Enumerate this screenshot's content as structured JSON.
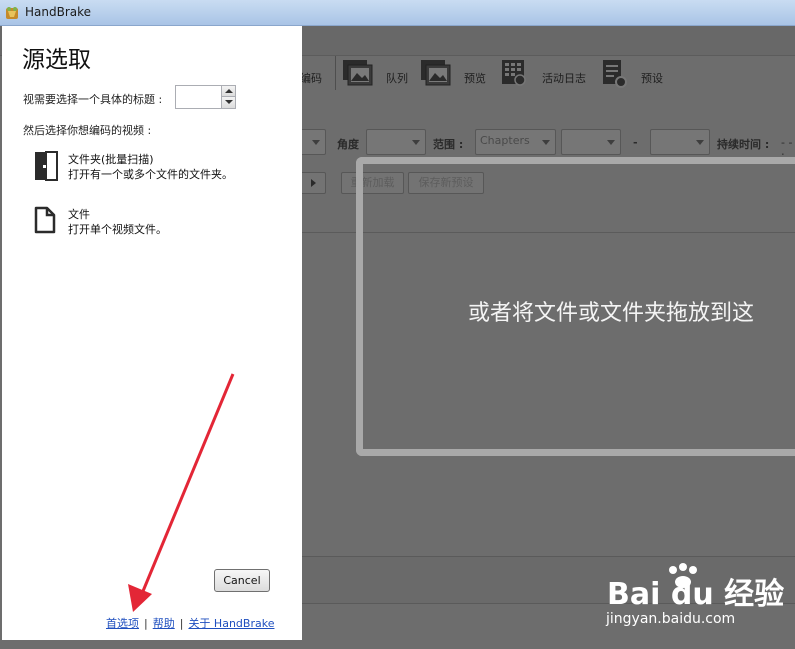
{
  "window": {
    "title": "HandBrake"
  },
  "toolbar": {
    "items": [
      {
        "label": "编码",
        "icon": "encode-icon"
      },
      {
        "label": "队列",
        "icon": "queue-icon"
      },
      {
        "label": "预览",
        "icon": "preview-icon"
      },
      {
        "label": "活动日志",
        "icon": "activity-log-icon"
      },
      {
        "label": "预设",
        "icon": "presets-icon"
      }
    ]
  },
  "source_bar": {
    "angle_label": "角度",
    "range_label": "范围 :",
    "range_value": "Chapters",
    "range_dash": "-",
    "duration_label": "持续时间 :",
    "duration_value": "- - :",
    "reload_label": "重新加载",
    "save_preset_label": "保存新预设"
  },
  "drop_zone": {
    "text": "或者将文件或文件夹拖放到这"
  },
  "source_panel": {
    "title": "源选取",
    "title_prompt": "视需要选择一个具体的标题 :",
    "title_value": "",
    "video_prompt": "然后选择你想编码的视频 :",
    "folder_option": {
      "title": "文件夹(批量扫描)",
      "description": "打开有一个或多个文件的文件夹。"
    },
    "file_option": {
      "title": "文件",
      "description": "打开单个视频文件。"
    },
    "cancel_label": "Cancel",
    "links": {
      "preferences": "首选项",
      "help": "帮助",
      "about": "关于 HandBrake",
      "separator": "|"
    }
  },
  "watermark": {
    "logo_text": "Bai du 经验",
    "url": "jingyan.baidu.com"
  },
  "colors": {
    "accent_link": "#1f4fbf",
    "annotation_arrow": "#e32636",
    "dim_background": "#6d6d6d"
  }
}
